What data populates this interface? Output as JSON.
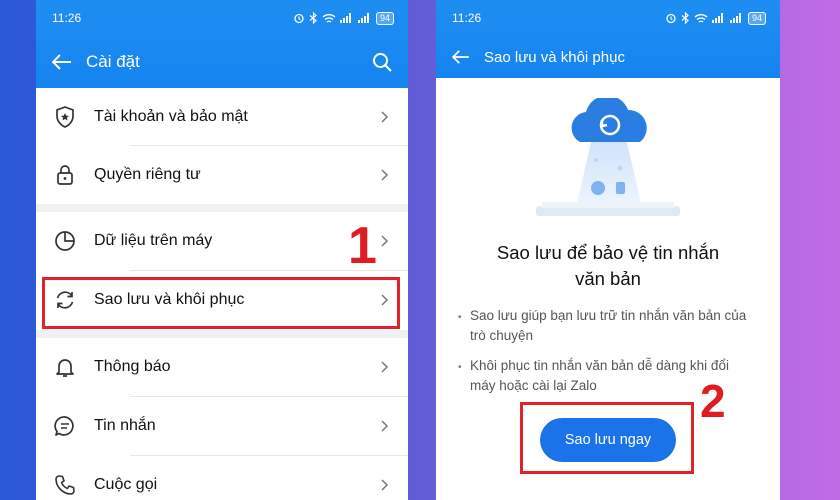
{
  "left": {
    "status": {
      "time": "11:26",
      "battery": "94"
    },
    "appbar": {
      "title": "Cài đặt"
    },
    "items": [
      {
        "label": "Tài khoản và bảo mật",
        "icon": "shield-icon"
      },
      {
        "label": "Quyền riêng tư",
        "icon": "lock-icon"
      },
      {
        "label": "Dữ liệu trên máy",
        "icon": "pie-chart-icon"
      },
      {
        "label": "Sao lưu và khôi phục",
        "icon": "sync-icon"
      },
      {
        "label": "Thông báo",
        "icon": "bell-icon"
      },
      {
        "label": "Tin nhắn",
        "icon": "message-icon"
      },
      {
        "label": "Cuộc gọi",
        "icon": "phone-icon"
      }
    ],
    "step_number": "1"
  },
  "right": {
    "status": {
      "time": "11:26",
      "battery": "94"
    },
    "appbar": {
      "title": "Sao lưu và khôi phục"
    },
    "heading_line1": "Sao lưu để bảo vệ tin nhắn",
    "heading_line2": "văn bản",
    "bullets": [
      {
        "line1": "Sao lưu giúp bạn lưu trữ tin nhắn văn bản của",
        "line2": "trò chuyện"
      },
      {
        "line1": "Khôi phục tin nhắn văn bản dễ dàng khi đổi",
        "line2": "máy hoặc cài lại Zalo"
      }
    ],
    "cta_label": "Sao lưu ngay",
    "step_number": "2"
  },
  "colors": {
    "accent": "#1a73e8",
    "highlight": "#e3212b",
    "header": "#1584f0"
  }
}
